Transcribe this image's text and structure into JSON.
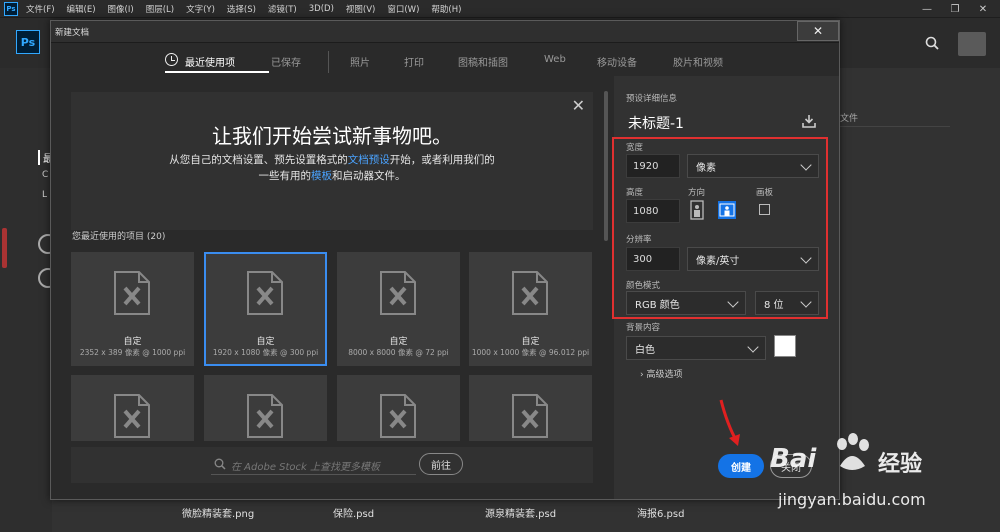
{
  "menubar": {
    "logo": "Ps",
    "items": [
      "文件(F)",
      "编辑(E)",
      "图像(I)",
      "图层(L)",
      "文字(Y)",
      "选择(S)",
      "滤镜(T)",
      "3D(D)",
      "视图(V)",
      "窗口(W)",
      "帮助(H)"
    ]
  },
  "home": {
    "logo": "Ps",
    "right_partial": "文件",
    "left_partial": [
      "最",
      "C",
      "L"
    ]
  },
  "bg_files": [
    {
      "name": "微脸精装套.png"
    },
    {
      "name": "保险.psd"
    },
    {
      "name": "源泉精装套.psd"
    },
    {
      "name": "海报6.psd"
    }
  ],
  "dialog": {
    "title": "新建文档",
    "tabs": [
      "最近使用项",
      "已保存",
      "照片",
      "打印",
      "图稿和插图",
      "Web",
      "移动设备",
      "胶片和视频"
    ],
    "welcome": {
      "heading": "让我们开始尝试新事物吧。",
      "line1_pre": "从您自己的文档设置、预先设置格式的",
      "line1_link": "文档预设",
      "line1_post": "开始，或者利用我们的",
      "line2_pre": "一些有用的",
      "line2_link": "模板",
      "line2_post": "和启动器文件。"
    },
    "recent_header": "您最近使用的项目 (20)",
    "recent_items": [
      {
        "name": "自定",
        "size": "2352 x 389 像素 @ 1000 ppi"
      },
      {
        "name": "自定",
        "size": "1920 x 1080 像素 @ 300 ppi"
      },
      {
        "name": "自定",
        "size": "8000 x 8000 像素 @ 72 ppi"
      },
      {
        "name": "自定",
        "size": "1000 x 1000 像素 @ 96.012 ppi"
      }
    ],
    "stock": {
      "placeholder": "在 Adobe Stock 上查找更多模板",
      "go": "前往"
    },
    "details": {
      "section": "预设详细信息",
      "doc_title": "未标题-1",
      "width_label": "宽度",
      "width": "1920",
      "width_unit": "像素",
      "height_label": "高度",
      "height": "1080",
      "orientation_label": "方向",
      "artboard_label": "画板",
      "resolution_label": "分辨率",
      "resolution": "300",
      "resolution_unit": "像素/英寸",
      "color_mode_label": "颜色模式",
      "color_mode": "RGB 颜色",
      "bit_depth": "8 位",
      "background_label": "背景内容",
      "background": "白色",
      "advanced": "高级选项"
    },
    "create": "创建",
    "close": "关闭"
  },
  "watermark": {
    "brand": "Bai",
    "brand2": "经验",
    "url": "jingyan.baidu.com"
  },
  "colors": {
    "accent": "#1473e6",
    "highlight": "#e03030",
    "link": "#4aa3ff"
  }
}
